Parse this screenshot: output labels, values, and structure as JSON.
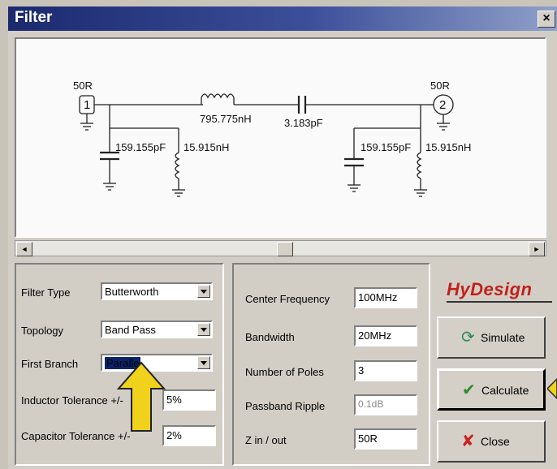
{
  "window": {
    "title": "Filter",
    "close_glyph": "×"
  },
  "schematic": {
    "port1": {
      "number": "1",
      "impedance": "50R"
    },
    "port2": {
      "number": "2",
      "impedance": "50R"
    },
    "components": {
      "c1": "159.155pF",
      "l1": "15.915nH",
      "l_series": "795.775nH",
      "c_series": "3.183pF",
      "c2": "159.155pF",
      "l2": "15.915nH"
    }
  },
  "scrollbar": {
    "left_glyph": "◄",
    "right_glyph": "►"
  },
  "filter_settings": {
    "filter_type": {
      "label": "Filter Type",
      "value": "Butterworth"
    },
    "topology": {
      "label": "Topology",
      "value": "Band Pass"
    },
    "first_branch": {
      "label": "First Branch",
      "value": "Paralle"
    },
    "inductor_tolerance": {
      "label": "Inductor Tolerance +/-",
      "value": "5%"
    },
    "capacitor_tolerance": {
      "label": "Capacitor Tolerance +/-",
      "value": "2%"
    }
  },
  "parameters": {
    "center_frequency": {
      "label": "Center Frequency",
      "value": "100MHz"
    },
    "bandwidth": {
      "label": "Bandwidth",
      "value": "20MHz"
    },
    "number_of_poles": {
      "label": "Number of Poles",
      "value": "3"
    },
    "passband_ripple": {
      "label": "Passband Ripple",
      "value": "0.1dB"
    },
    "z_in_out": {
      "label": "Z in / out",
      "value": "50R"
    }
  },
  "brand": {
    "logo": "HyDesign"
  },
  "buttons": {
    "simulate": {
      "label": "Simulate",
      "icon": "refresh-icon",
      "color": "#2e8b57"
    },
    "calculate": {
      "label": "Calculate",
      "icon": "checkmark-icon",
      "color": "#2e8b2e"
    },
    "close": {
      "label": "Close",
      "icon": "x-icon",
      "color": "#cc2222"
    }
  },
  "colors": {
    "accent_arrow": "#f0d21c",
    "title_bar": "#1b2a6e",
    "logo": "#c0221a"
  }
}
